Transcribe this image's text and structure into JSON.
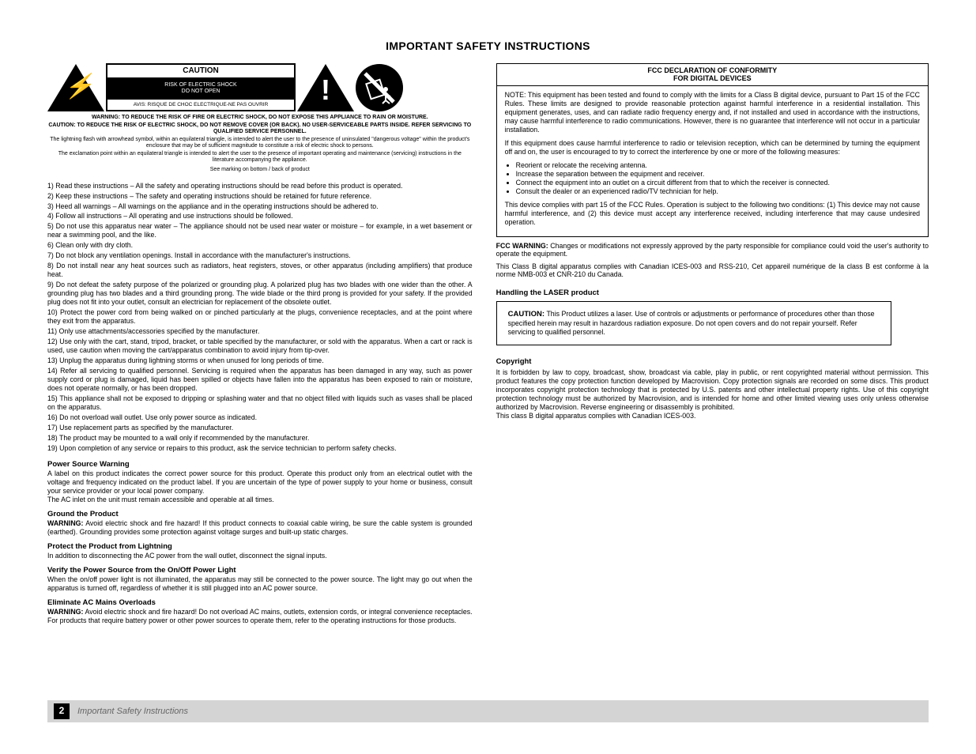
{
  "pageTitle": "IMPORTANT SAFETY INSTRUCTIONS",
  "cautionBox": {
    "top": "CAUTION",
    "mid": "RISK OF ELECTRIC SHOCK\nDO NOT OPEN",
    "bot": "AVIS: RISQUE DE CHOC ELECTRIQUE-NE PAS OUVRIR"
  },
  "warnLine1": "WARNING: TO REDUCE THE RISK OF FIRE OR ELECTRIC SHOCK, DO NOT EXPOSE THIS APPLIANCE TO RAIN OR MOISTURE.",
  "cautionBlock": "CAUTION: TO REDUCE THE RISK OF ELECTRIC SHOCK, DO NOT REMOVE COVER (OR BACK). NO USER-SERVICEABLE PARTS INSIDE. REFER SERVICING TO QUALIFIED SERVICE PERSONNEL.",
  "triBoltDesc": "The lightning flash with arrowhead symbol, within an equilateral triangle, is intended to alert the user to the presence of uninsulated \"dangerous voltage\" within the product's enclosure that may be of sufficient magnitude to constitute a risk of electric shock to persons.",
  "triBangDesc": "The exclamation point within an equilateral triangle is intended to alert the user to the presence of important operating and maintenance (servicing) instructions in the literature accompanying the appliance.",
  "seeMark": "See marking on bottom / back of product",
  "instructions": [
    "Read these instructions – All the safety and operating instructions should be read before this product is operated.",
    "Keep these instructions – The safety and operating instructions should be retained for future reference.",
    "Heed all warnings – All warnings on the appliance and in the operating instructions should be adhered to.",
    "Follow all instructions – All operating and use instructions should be followed.",
    "Do not use this apparatus near water – The appliance should not be used near water or moisture – for example, in a wet basement or near a swimming pool, and the like.",
    "Clean only with dry cloth.",
    "Do not block any ventilation openings. Install in accordance with the manufacturer's instructions.",
    "Do not install near any heat sources such as radiators, heat registers, stoves, or other apparatus (including amplifiers) that produce heat.",
    "Do not defeat the safety purpose of the polarized or grounding plug. A polarized plug has two blades with one wider than the other. A grounding plug has two blades and a third grounding prong. The wide blade or the third prong is provided for your safety. If the provided plug does not fit into your outlet, consult an electrician for replacement of the obsolete outlet.",
    "Protect the power cord from being walked on or pinched particularly at the plugs, convenience receptacles, and at the point where they exit from the apparatus.",
    "Only use attachments/accessories specified by the manufacturer.",
    "Use only with the cart, stand, tripod, bracket, or table specified by the manufacturer, or sold with the apparatus. When a cart or rack is used, use caution when moving the cart/apparatus combination to avoid injury from tip-over.",
    "Unplug the apparatus during lightning storms or when unused for long periods of time.",
    "Refer all servicing to qualified personnel. Servicing is required when the apparatus has been damaged in any way, such as power supply cord or plug is damaged, liquid has been spilled or objects have fallen into the apparatus has been exposed to rain or moisture, does not operate normally, or has been dropped.",
    "This appliance shall not be exposed to dripping or splashing water and that no object filled with liquids such as vases shall be placed on the apparatus.",
    "Do not overload wall outlet. Use only power source as indicated.",
    "Use replacement parts as specified by the manufacturer.",
    "The product may be mounted to a wall only if recommended by the manufacturer.",
    "Upon completion of any service or repairs to this product, ask the service technician to perform safety checks."
  ],
  "powerSource": {
    "heading": "Power Source Warning",
    "body": "A label on this product indicates the correct power source for this product. Operate this product only from an electrical outlet with the voltage and frequency indicated on the product label. If you are uncertain of the type of power supply to your home or business, consult your service provider or your local power company.\nThe AC inlet on the unit must remain accessible and operable at all times."
  },
  "groundTitle": "Ground the Product",
  "groundWarn": {
    "label": "WARNING:",
    "body": "Avoid electric shock and fire hazard! If this product connects to coaxial cable wiring, be sure the cable system is grounded (earthed). Grounding provides some protection against voltage surges and built-up static charges."
  },
  "lightningTitle": "Protect the Product from Lightning",
  "lightningBody": "In addition to disconnecting the AC power from the wall outlet, disconnect the signal inputs.",
  "mainsTitle": "Verify the Power Source from the On/Off Power Light",
  "mainsBody": "When the on/off power light is not illuminated, the apparatus may still be connected to the power source. The light may go out when the apparatus is turned off, regardless of whether it is still plugged into an AC power source.",
  "overloadTitle": "Eliminate AC Mains Overloads",
  "overloadWarn": {
    "label": "WARNING:",
    "body": "Avoid electric shock and fire hazard! Do not overload AC mains, outlets, extension cords, or integral convenience receptacles. For products that require battery power or other power sources to operate them, refer to the operating instructions for those products."
  },
  "fcc": {
    "header1": "FCC DECLARATION OF CONFORMITY",
    "header2": "FOR DIGITAL DEVICES",
    "p1": "NOTE: This equipment has been tested and found to comply with the limits for a Class B digital device, pursuant to Part 15 of the FCC Rules. These limits are designed to provide reasonable protection against harmful interference in a residential installation. This equipment generates, uses, and can radiate radio frequency energy and, if not installed and used in accordance with the instructions, may cause harmful interference to radio communications. However, there is no guarantee that interference will not occur in a particular installation.",
    "p2": "If this equipment does cause harmful interference to radio or television reception, which can be determined by turning the equipment off and on, the user is encouraged to try to correct the interference by one or more of the following measures:",
    "bullets": [
      "Reorient or relocate the receiving antenna.",
      "Increase the separation between the equipment and receiver.",
      "Connect the equipment into an outlet on a circuit different from that to which the receiver is connected.",
      "Consult the dealer or an experienced radio/TV technician for help."
    ],
    "p3": "This device complies with part 15 of the FCC Rules. Operation is subject to the following two conditions: (1) This device may not cause harmful interference, and (2) this device must accept any interference received, including interference that may cause undesired operation.",
    "footWarnLabel": "FCC WARNING:",
    "footWarnBody": "Changes or modifications not expressly approved by the party responsible for compliance could void the user's authority to operate the equipment.",
    "canadaBody": "This Class B digital apparatus complies with Canadian ICES-003 and RSS-210, Cet appareil numérique de la class B est conforme à la norme NMB-003 et CNR-210 du Canada."
  },
  "laser": {
    "heading": "Handling the LASER product",
    "label": "CAUTION:",
    "body": "This Product utilizes a laser. Use of controls or adjustments or performance of procedures other than those specified herein may result in hazardous radiation exposure. Do not open covers and do not repair yourself. Refer servicing to qualified personnel."
  },
  "copyrightHead": "Copyright",
  "copyrightBody": "It is forbidden by law to copy, broadcast, show, broadcast via cable, play in public, or rent copyrighted material without permission. This product features the copy protection function developed by Macrovision. Copy protection signals are recorded on some discs. This product incorporates copyright protection technology that is protected by U.S. patents and other intellectual property rights. Use of this copyright protection technology must be authorized by Macrovision, and is intended for home and other limited viewing uses only unless otherwise authorized by Macrovision. Reverse engineering or disassembly is prohibited.\nThis class B digital apparatus complies with Canadian ICES-003.",
  "footer": {
    "num": "2",
    "label": "Important Safety Instructions"
  }
}
